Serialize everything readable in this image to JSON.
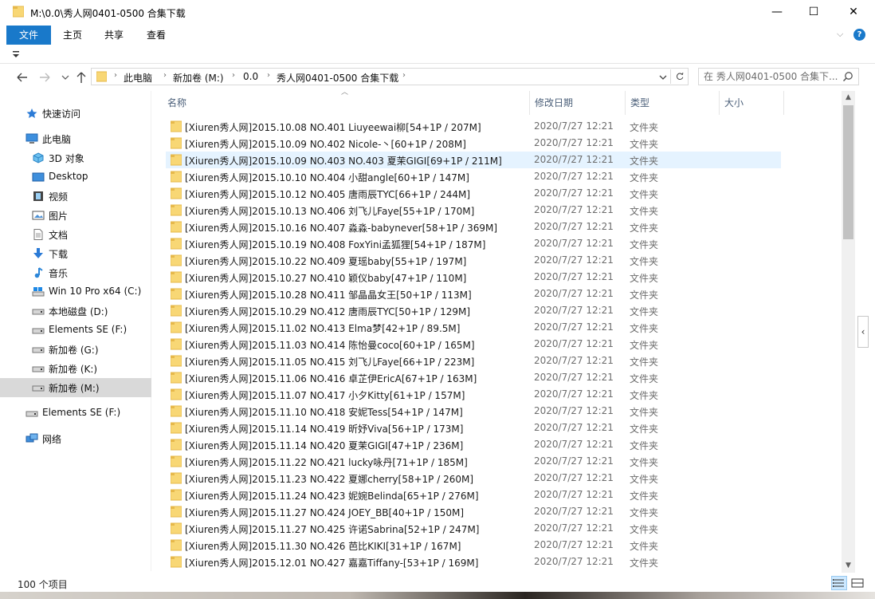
{
  "window": {
    "title": "M:\\0.0\\秀人网0401-0500 合集下载",
    "min_glyph": "—",
    "max_glyph": "☐",
    "close_glyph": "✕"
  },
  "ribbon": {
    "tabs": [
      {
        "label": "文件",
        "active": true
      },
      {
        "label": "主页"
      },
      {
        "label": "共享"
      },
      {
        "label": "查看"
      }
    ],
    "help_glyph": "?",
    "collapse_glyph": "⌵"
  },
  "address": {
    "crumbs": [
      "此电脑",
      "新加卷 (M:)",
      "0.0",
      "秀人网0401-0500 合集下载"
    ],
    "search_placeholder": "在 秀人网0401-0500 合集下... "
  },
  "sidebar": {
    "items": [
      {
        "label": "快速访问",
        "icon": "star-icon"
      },
      {
        "label": "此电脑",
        "icon": "computer-icon"
      },
      {
        "label": "3D 对象",
        "icon": "cube-icon"
      },
      {
        "label": "Desktop",
        "icon": "desktop-icon"
      },
      {
        "label": "视频",
        "icon": "video-icon"
      },
      {
        "label": "图片",
        "icon": "picture-icon"
      },
      {
        "label": "文档",
        "icon": "document-icon"
      },
      {
        "label": "下载",
        "icon": "download-icon"
      },
      {
        "label": "音乐",
        "icon": "music-icon"
      },
      {
        "label": "Win 10 Pro x64 (C:)",
        "icon": "windows-drive-icon"
      },
      {
        "label": "本地磁盘 (D:)",
        "icon": "drive-icon"
      },
      {
        "label": "Elements SE (F:)",
        "icon": "drive-icon"
      },
      {
        "label": "新加卷 (G:)",
        "icon": "drive-icon"
      },
      {
        "label": "新加卷 (K:)",
        "icon": "drive-icon"
      },
      {
        "label": "新加卷 (M:)",
        "icon": "drive-icon",
        "selected": true
      },
      {
        "label": "Elements SE (F:)",
        "icon": "drive-icon"
      },
      {
        "label": "网络",
        "icon": "network-icon"
      }
    ]
  },
  "columns": {
    "name": "名称",
    "date": "修改日期",
    "type": "类型",
    "size": "大小"
  },
  "files": [
    {
      "name": "[Xiuren秀人网]2015.10.08 NO.401 Liuyeewai柳[54+1P / 207M]",
      "date": "2020/7/27 12:21",
      "type": "文件夹"
    },
    {
      "name": "[Xiuren秀人网]2015.10.09 NO.402 Nicole-丶[60+1P / 208M]",
      "date": "2020/7/27 12:21",
      "type": "文件夹"
    },
    {
      "name": "[Xiuren秀人网]2015.10.09 NO.403 NO.403 夏茉GIGI[69+1P / 211M]",
      "date": "2020/7/27 12:21",
      "type": "文件夹",
      "highlight": true
    },
    {
      "name": "[Xiuren秀人网]2015.10.10 NO.404 小甜angle[60+1P / 147M]",
      "date": "2020/7/27 12:21",
      "type": "文件夹"
    },
    {
      "name": "[Xiuren秀人网]2015.10.12 NO.405 唐雨辰TYC[66+1P / 244M]",
      "date": "2020/7/27 12:21",
      "type": "文件夹"
    },
    {
      "name": "[Xiuren秀人网]2015.10.13 NO.406 刘飞儿Faye[55+1P / 170M]",
      "date": "2020/7/27 12:21",
      "type": "文件夹"
    },
    {
      "name": "[Xiuren秀人网]2015.10.16 NO.407 淼淼-babynever[58+1P / 369M]",
      "date": "2020/7/27 12:21",
      "type": "文件夹"
    },
    {
      "name": "[Xiuren秀人网]2015.10.19 NO.408 FoxYini孟狐狸[54+1P / 187M]",
      "date": "2020/7/27 12:21",
      "type": "文件夹"
    },
    {
      "name": "[Xiuren秀人网]2015.10.22 NO.409 夏瑶baby[55+1P / 197M]",
      "date": "2020/7/27 12:21",
      "type": "文件夹"
    },
    {
      "name": "[Xiuren秀人网]2015.10.27 NO.410 颖仪baby[47+1P / 110M]",
      "date": "2020/7/27 12:21",
      "type": "文件夹"
    },
    {
      "name": "[Xiuren秀人网]2015.10.28 NO.411 邹晶晶女王[50+1P / 113M]",
      "date": "2020/7/27 12:21",
      "type": "文件夹"
    },
    {
      "name": "[Xiuren秀人网]2015.10.29 NO.412 唐雨辰TYC[50+1P / 129M]",
      "date": "2020/7/27 12:21",
      "type": "文件夹"
    },
    {
      "name": "[Xiuren秀人网]2015.11.02 NO.413 Elma梦[42+1P / 89.5M]",
      "date": "2020/7/27 12:21",
      "type": "文件夹"
    },
    {
      "name": "[Xiuren秀人网]2015.11.03 NO.414 陈怡曼coco[60+1P / 165M]",
      "date": "2020/7/27 12:21",
      "type": "文件夹"
    },
    {
      "name": "[Xiuren秀人网]2015.11.05 NO.415 刘飞儿Faye[66+1P / 223M]",
      "date": "2020/7/27 12:21",
      "type": "文件夹"
    },
    {
      "name": "[Xiuren秀人网]2015.11.06 NO.416 卓芷伊EricA[67+1P / 163M]",
      "date": "2020/7/27 12:21",
      "type": "文件夹"
    },
    {
      "name": "[Xiuren秀人网]2015.11.07 NO.417 小夕Kitty[61+1P / 157M]",
      "date": "2020/7/27 12:21",
      "type": "文件夹"
    },
    {
      "name": "[Xiuren秀人网]2015.11.10 NO.418 安妮Tess[54+1P / 147M]",
      "date": "2020/7/27 12:21",
      "type": "文件夹"
    },
    {
      "name": "[Xiuren秀人网]2015.11.14 NO.419 昕妤Viva[56+1P / 173M]",
      "date": "2020/7/27 12:21",
      "type": "文件夹"
    },
    {
      "name": "[Xiuren秀人网]2015.11.14 NO.420 夏茉GIGI[47+1P / 236M]",
      "date": "2020/7/27 12:21",
      "type": "文件夹"
    },
    {
      "name": "[Xiuren秀人网]2015.11.22 NO.421 lucky咏丹[71+1P / 185M]",
      "date": "2020/7/27 12:21",
      "type": "文件夹"
    },
    {
      "name": "[Xiuren秀人网]2015.11.23 NO.422 夏娜cherry[58+1P / 260M]",
      "date": "2020/7/27 12:21",
      "type": "文件夹"
    },
    {
      "name": "[Xiuren秀人网]2015.11.24 NO.423 妮婉Belinda[65+1P / 276M]",
      "date": "2020/7/27 12:21",
      "type": "文件夹"
    },
    {
      "name": "[Xiuren秀人网]2015.11.27 NO.424 JOEY_BB[40+1P / 150M]",
      "date": "2020/7/27 12:21",
      "type": "文件夹"
    },
    {
      "name": "[Xiuren秀人网]2015.11.27 NO.425 许诺Sabrina[52+1P / 247M]",
      "date": "2020/7/27 12:21",
      "type": "文件夹"
    },
    {
      "name": "[Xiuren秀人网]2015.11.30 NO.426 芭比KIKI[31+1P / 167M]",
      "date": "2020/7/27 12:21",
      "type": "文件夹"
    },
    {
      "name": "[Xiuren秀人网]2015.12.01 NO.427 嘉嘉Tiffany-[53+1P / 169M]",
      "date": "2020/7/27 12:21",
      "type": "文件夹"
    }
  ],
  "status": {
    "count": "100 个项目"
  },
  "colors": {
    "accent": "#1979ca",
    "folder": "#f8d775",
    "folder_dark": "#e6b84a",
    "selection": "#d9d9d9",
    "hover_row": "#e5f3ff"
  }
}
